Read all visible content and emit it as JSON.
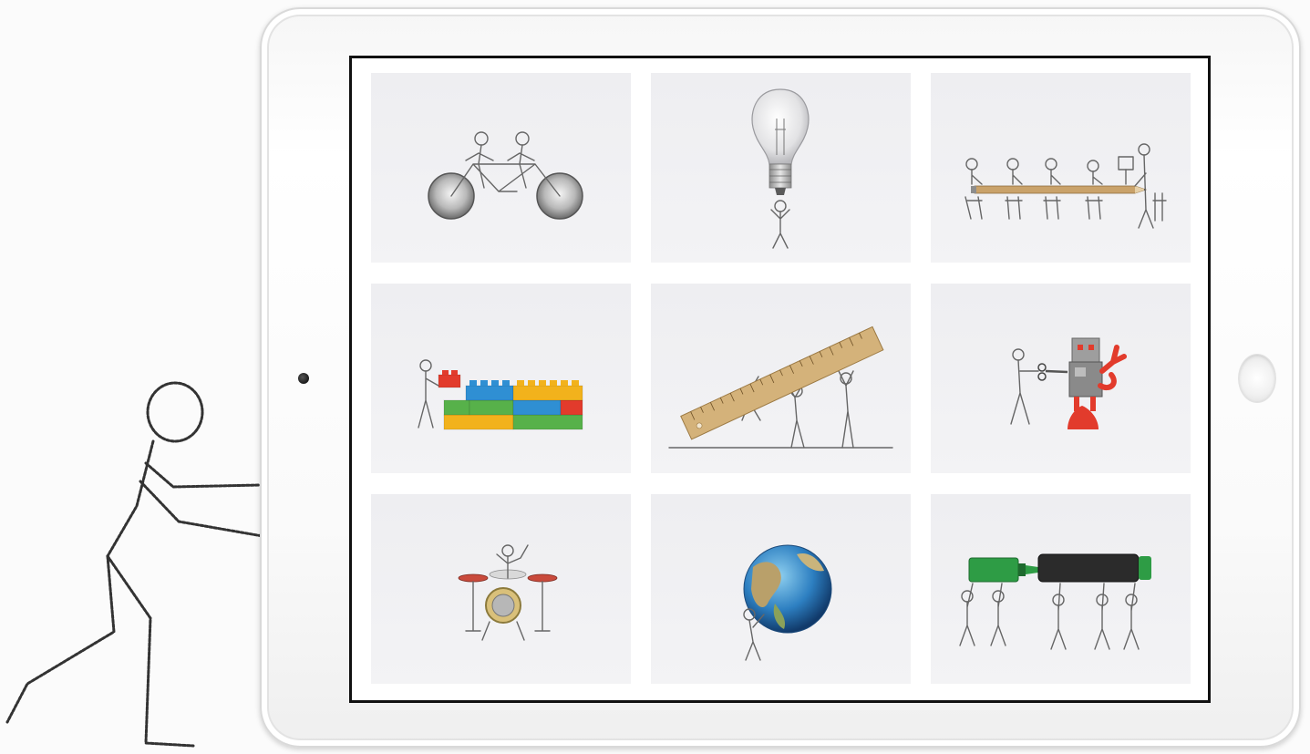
{
  "window": {
    "title": ""
  },
  "decorations": {
    "stick_figure": "stick-figure-pushing-tablet-icon",
    "camera": "front-camera-icon",
    "home_button": "home-button-icon"
  },
  "gallery": {
    "tiles": [
      {
        "icon": "tandem-bicycle-icon"
      },
      {
        "icon": "light-bulb-icon"
      },
      {
        "icon": "pencil-conference-table-icon"
      },
      {
        "icon": "building-blocks-icon"
      },
      {
        "icon": "ruler-lifting-icon"
      },
      {
        "icon": "robot-scissors-icon"
      },
      {
        "icon": "drum-kit-icon"
      },
      {
        "icon": "globe-carrying-icon"
      },
      {
        "icon": "highlighter-carrying-icon"
      }
    ]
  },
  "colors": {
    "screen_border": "#111111",
    "tile_background": "#efeff2",
    "block_yellow": "#f2b21c",
    "block_blue": "#2f8fd3",
    "block_green": "#57b14a",
    "block_red": "#e23b2c",
    "ruler_wood": "#d4b27a",
    "highlighter_green": "#2e9c45",
    "highlighter_body": "#2b2b2b",
    "globe_ocean": "#2d7fc1"
  }
}
